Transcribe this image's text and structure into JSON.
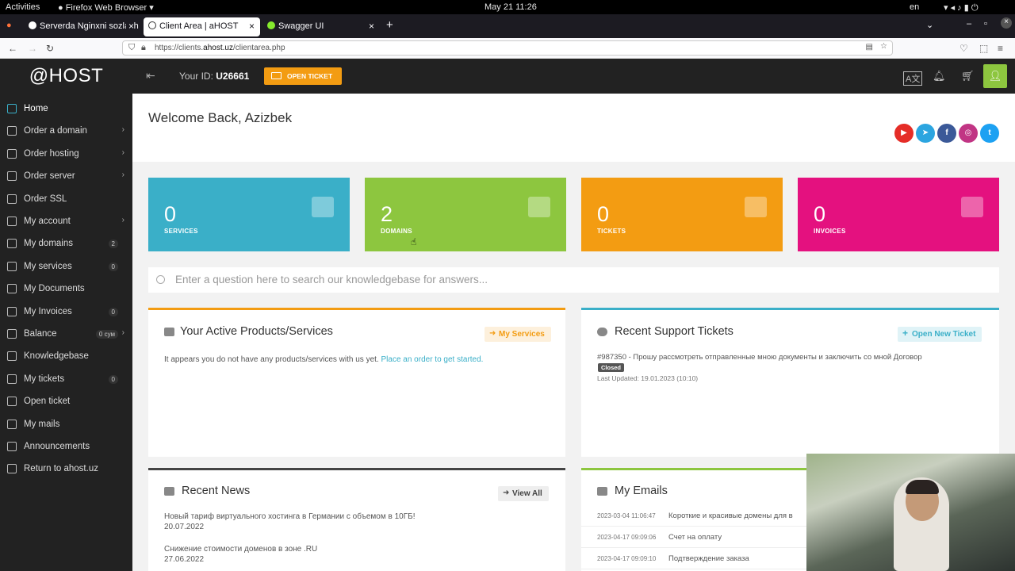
{
  "gnome": {
    "activities": "Activities",
    "app": "Firefox Web Browser",
    "clock": "May 21  11:26",
    "lang": "en"
  },
  "tabs": [
    {
      "label": "Serverda Nginxni sozlash"
    },
    {
      "label": "Client Area | aHOST"
    },
    {
      "label": "Swagger UI"
    }
  ],
  "url": {
    "prefix": "https://clients.",
    "domain": "ahost.uz",
    "path": "/clientarea.php"
  },
  "sidebar": {
    "logo": "@HOST",
    "items": [
      {
        "label": "Home",
        "badge": null,
        "arrow": null
      },
      {
        "label": "Order a domain",
        "badge": null,
        "arrow": "›"
      },
      {
        "label": "Order hosting",
        "badge": null,
        "arrow": "›"
      },
      {
        "label": "Order server",
        "badge": null,
        "arrow": "›"
      },
      {
        "label": "Order SSL",
        "badge": null,
        "arrow": null
      },
      {
        "label": "My account",
        "badge": null,
        "arrow": "›"
      },
      {
        "label": "My domains",
        "badge": "2",
        "arrow": null
      },
      {
        "label": "My services",
        "badge": "0",
        "arrow": null
      },
      {
        "label": "My Documents",
        "badge": null,
        "arrow": null
      },
      {
        "label": "My Invoices",
        "badge": "0",
        "arrow": null
      },
      {
        "label": "Balance",
        "badge": "0 сум",
        "arrow": "›"
      },
      {
        "label": "Knowledgebase",
        "badge": null,
        "arrow": null
      },
      {
        "label": "My tickets",
        "badge": "0",
        "arrow": null
      },
      {
        "label": "Open ticket",
        "badge": null,
        "arrow": null
      },
      {
        "label": "My mails",
        "badge": null,
        "arrow": null
      },
      {
        "label": "Announcements",
        "badge": null,
        "arrow": null
      },
      {
        "label": "Return to ahost.uz",
        "badge": null,
        "arrow": null
      }
    ]
  },
  "topbar": {
    "id_label": "Your ID:",
    "id_value": "U26661",
    "open_ticket": "OPEN TICKET"
  },
  "welcome": "Welcome Back, Azizbek",
  "tiles": [
    {
      "value": "0",
      "label": "SERVICES",
      "color": "#3aafc8"
    },
    {
      "value": "2",
      "label": "DOMAINS",
      "color": "#8dc63f"
    },
    {
      "value": "0",
      "label": "TICKETS",
      "color": "#f39c12"
    },
    {
      "value": "0",
      "label": "INVOICES",
      "color": "#e4117f"
    }
  ],
  "kb_placeholder": "Enter a question here to search our knowledgebase for answers...",
  "products": {
    "title": "Your Active Products/Services",
    "button": "My Services",
    "text": "It appears you do not have any products/services with us yet.",
    "link": "Place an order to get started."
  },
  "tickets": {
    "title": "Recent Support Tickets",
    "button": "Open New Ticket",
    "item": "#987350 - Прошу рассмотреть отправленные мною документы и заключить со мной Договор",
    "status": "Closed",
    "updated": "Last Updated: 19.01.2023 (10:10)"
  },
  "news": {
    "title": "Recent News",
    "button": "View All",
    "items": [
      {
        "title": "Новый тариф виртуального хостинга в Германии с объемом в 10ГБ!",
        "date": "20.07.2022"
      },
      {
        "title": "Снижение стоимости доменов в зоне .RU",
        "date": "27.06.2022"
      }
    ]
  },
  "emails": {
    "title": "My Emails",
    "items": [
      {
        "date": "2023-03-04 11:06:47",
        "subject": "Короткие и красивые домены для в"
      },
      {
        "date": "2023-04-17 09:09:06",
        "subject": "Счет на оплату"
      },
      {
        "date": "2023-04-17 09:09:10",
        "subject": "Подтверждение заказа"
      }
    ]
  },
  "social": [
    {
      "name": "youtube",
      "color": "#e52d27",
      "glyph": "▶"
    },
    {
      "name": "telegram",
      "color": "#2ca5e0",
      "glyph": "➤"
    },
    {
      "name": "facebook",
      "color": "#3b5998",
      "glyph": "f"
    },
    {
      "name": "instagram",
      "color": "#c13584",
      "glyph": "◎"
    },
    {
      "name": "twitter",
      "color": "#1da1f2",
      "glyph": "t"
    }
  ]
}
